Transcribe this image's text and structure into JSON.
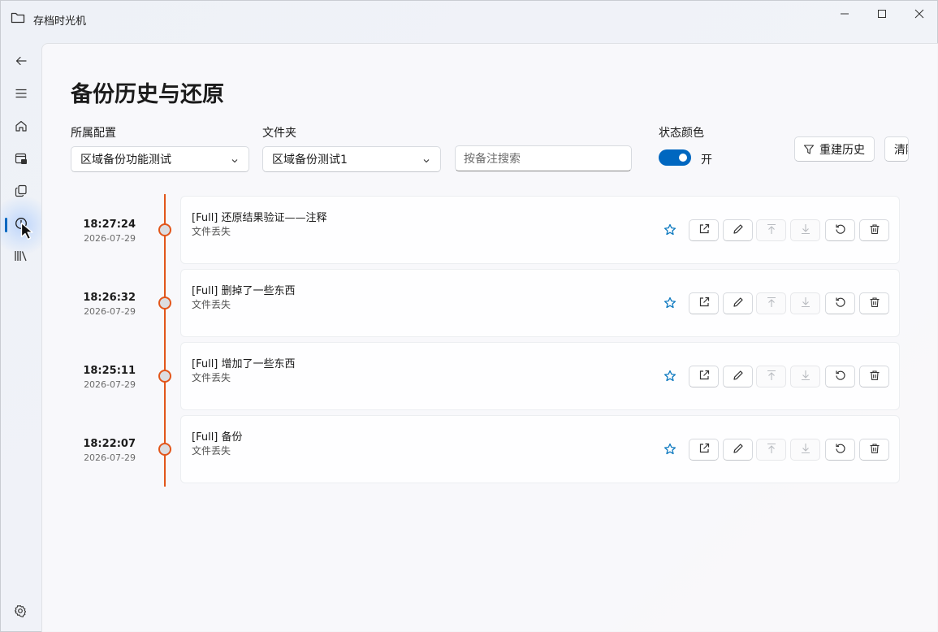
{
  "app": {
    "title": "存档时光机",
    "window_controls": [
      "minimize-icon",
      "maximize-icon",
      "close-icon"
    ]
  },
  "nav": {
    "items": [
      "back-icon",
      "menu-icon",
      "home-icon",
      "backup-icon",
      "copy-icon",
      "history-icon",
      "library-icon"
    ],
    "active": "history-icon",
    "footer": "settings-icon"
  },
  "page": {
    "title": "备份历史与还原",
    "config": {
      "label": "所属配置",
      "value": "区域备份功能测试"
    },
    "folder": {
      "label": "文件夹",
      "value": "区域备份测试1"
    },
    "search": {
      "placeholder": "按备注搜索"
    },
    "status_color": {
      "label": "状态颜色",
      "state_text": "开",
      "on": true
    },
    "buttons": {
      "rebuild": "重建历史",
      "clear": "清除"
    }
  },
  "colors": {
    "accent": "#0067c0",
    "timeline": "#e2561b",
    "star": "#0f7ac0"
  },
  "history": [
    {
      "time": "18:27:24",
      "date": "2026-07-29",
      "title": "[Full] 还原结果验证——注释",
      "subtitle": "文件丢失"
    },
    {
      "time": "18:26:32",
      "date": "2026-07-29",
      "title": "[Full] 删掉了一些东西",
      "subtitle": "文件丢失"
    },
    {
      "time": "18:25:11",
      "date": "2026-07-29",
      "title": "[Full] 增加了一些东西",
      "subtitle": "文件丢失"
    },
    {
      "time": "18:22:07",
      "date": "2026-07-29",
      "title": "[Full] 备份",
      "subtitle": "文件丢失"
    }
  ],
  "row_actions": [
    "star-icon",
    "open-icon",
    "edit-icon",
    "move-up-icon",
    "move-down-icon",
    "restore-icon",
    "delete-icon"
  ]
}
